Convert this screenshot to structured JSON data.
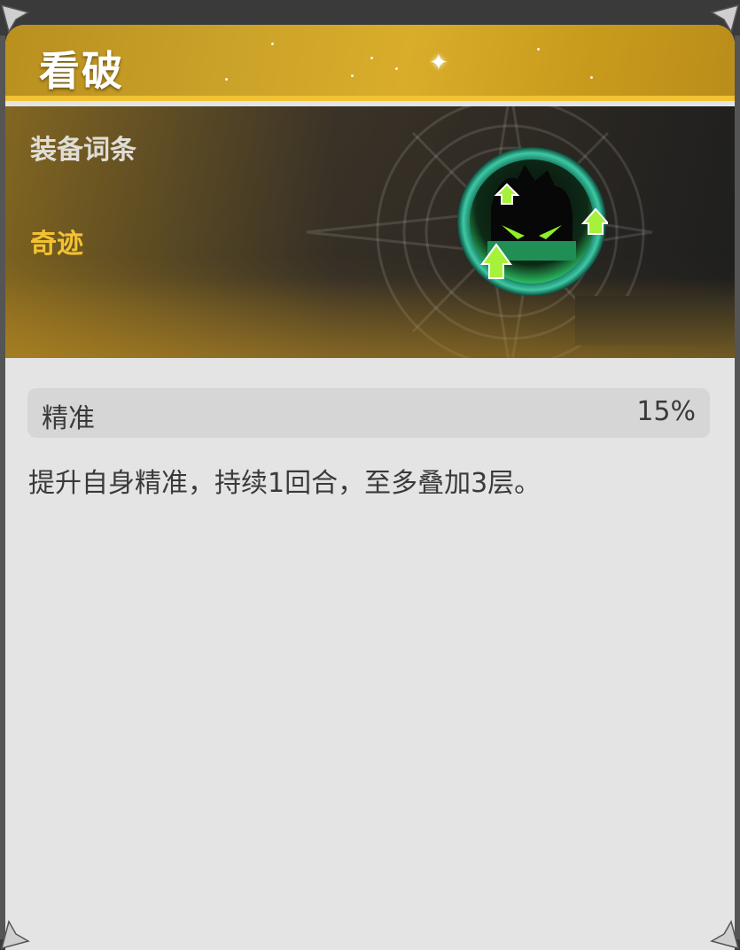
{
  "card": {
    "title": "看破",
    "affix_label": "装备词条",
    "set_label": "奇迹",
    "emblem_icon": "precision-buff-icon",
    "stat": {
      "name": "精准",
      "value": "15%"
    },
    "description": "提升自身精准，持续1回合，至多叠加3层。"
  },
  "colors": {
    "gold": "#f3c232",
    "title_text": "#ffffff",
    "body_bg": "#e4e4e4",
    "body_text": "#3a3a3a",
    "emblem_green": "#7fe21c"
  }
}
